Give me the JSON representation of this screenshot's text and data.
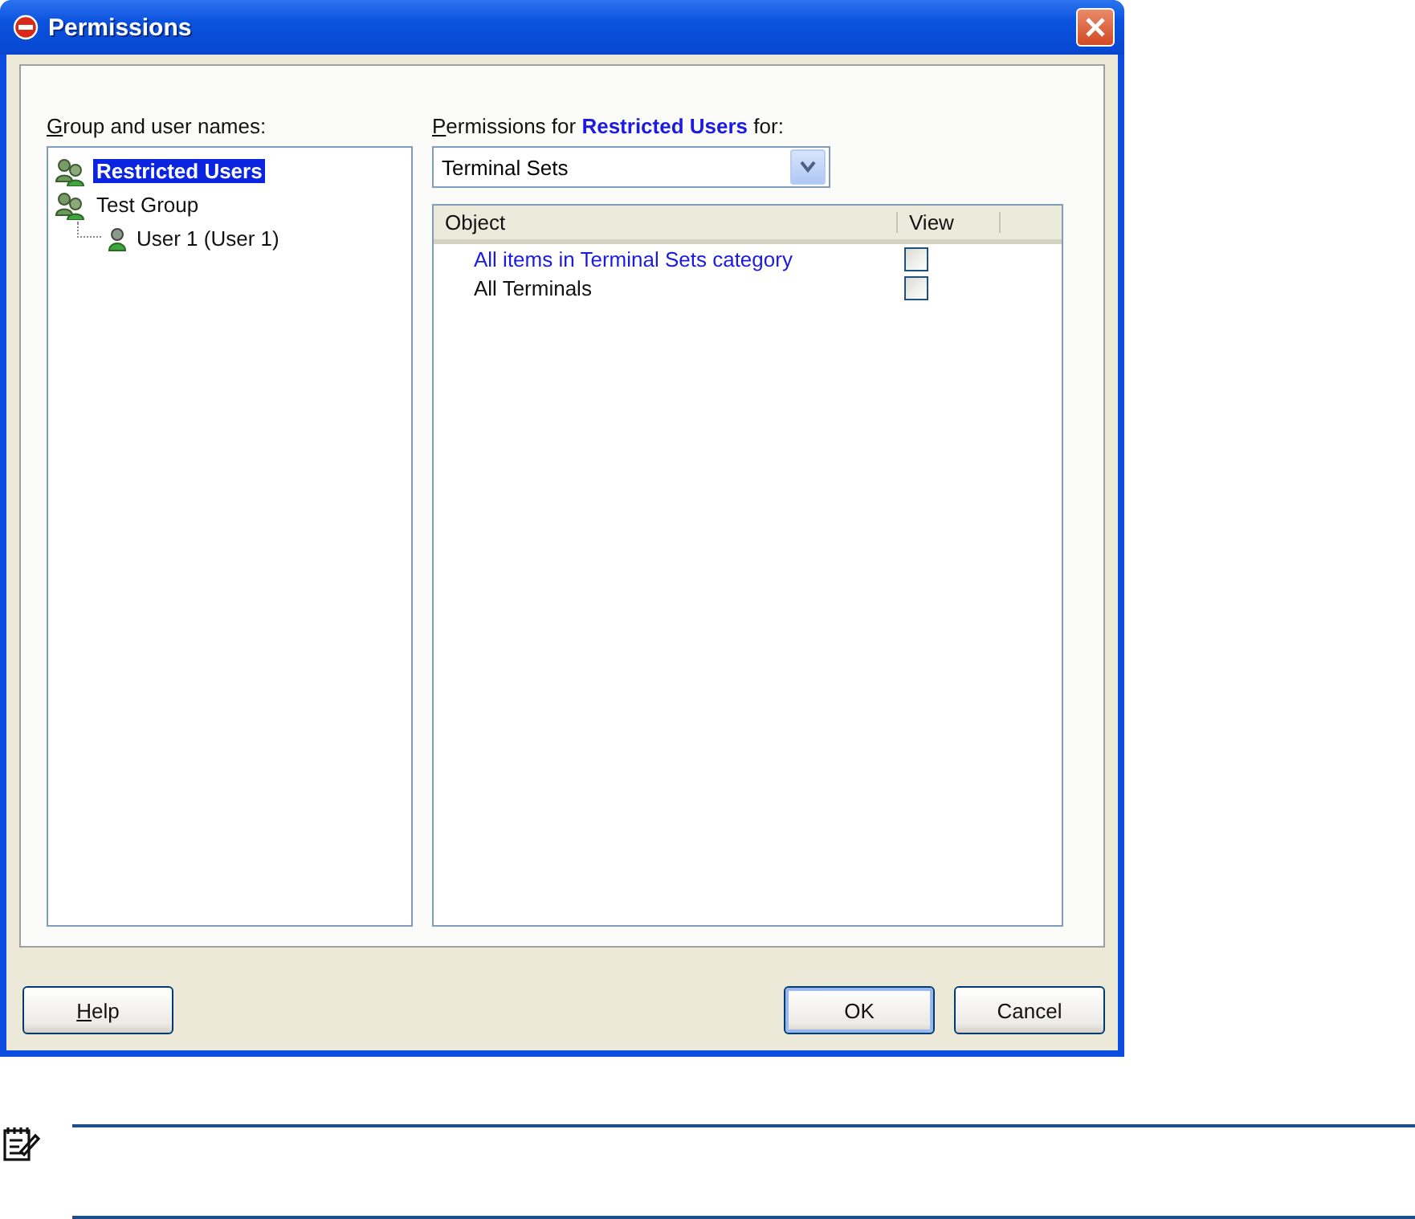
{
  "window": {
    "title": "Permissions"
  },
  "tree": {
    "label": "Group and user names:",
    "items": [
      {
        "name": "Restricted Users",
        "kind": "group",
        "selected": true
      },
      {
        "name": "Test Group",
        "kind": "group",
        "selected": false,
        "children": [
          {
            "name": "User 1 (User 1)",
            "kind": "user",
            "selected": false
          }
        ]
      }
    ]
  },
  "permissions": {
    "label": "Permissions for **Restricted Users**  for:",
    "category": "Terminal Sets",
    "columns": [
      "Object",
      "View"
    ],
    "rows": [
      {
        "object": "All items in Terminal Sets category",
        "kind": "category",
        "view": false
      },
      {
        "object": "All Terminals",
        "kind": "item",
        "view": false
      }
    ]
  },
  "buttons": [
    {
      "label": "Help",
      "default": false
    },
    {
      "label": "OK",
      "default": true
    },
    {
      "label": "Cancel",
      "default": false
    }
  ]
}
